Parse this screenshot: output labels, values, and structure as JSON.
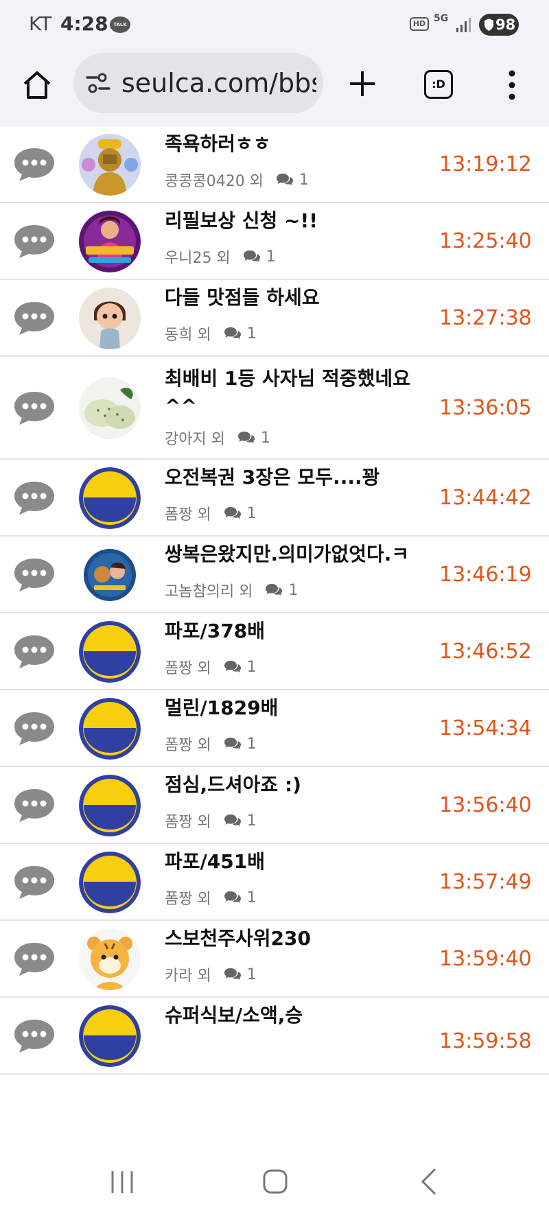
{
  "status_bar": {
    "carrier": "KT",
    "time": "4:28",
    "talk_badge": "TALK",
    "hd_badge": "HD",
    "network": "5G",
    "battery": "98",
    "icons": [
      "kakaotalk-icon",
      "hd-voice-icon",
      "5g-icon",
      "signal-icon",
      "battery-icon"
    ]
  },
  "browser": {
    "url": "seulca.com/bbs",
    "tabs_label": ":D",
    "icons": [
      "home-icon",
      "site-settings-icon",
      "new-tab-icon",
      "tab-switcher-icon",
      "more-menu-icon"
    ]
  },
  "colors": {
    "time": "#e0561a",
    "meta": "#777777",
    "divider": "#e4e4e4"
  },
  "posts": [
    {
      "title": "족욕하러ㅎㅎ",
      "author": "콩콩콩0420 외",
      "comments": "1",
      "time": "13:19:12",
      "avatar": "gold-figure"
    },
    {
      "title": "리필보상 신청 ~!!",
      "author": "우니25 외",
      "comments": "1",
      "time": "13:25:40",
      "avatar": "game-character"
    },
    {
      "title": "다들 맛점들 하세요",
      "author": "동희 외",
      "comments": "1",
      "time": "13:27:38",
      "avatar": "toddler-doll"
    },
    {
      "title": "최배비 1등 사자님 적중했네요 ^^",
      "author": "강아지 외",
      "comments": "1",
      "time": "13:36:05",
      "avatar": "rice-cakes"
    },
    {
      "title": "오전복권 3장은 모두....꽝",
      "author": "폼짱 외",
      "comments": "1",
      "time": "13:44:42",
      "avatar": "yellow-smile"
    },
    {
      "title": "쌍복은왔지만.의미가없엇다.ㅋ",
      "author": "고놈참의리 외",
      "comments": "1",
      "time": "13:46:19",
      "avatar": "game-banner"
    },
    {
      "title": "파포/378배",
      "author": "폼짱 외",
      "comments": "1",
      "time": "13:46:52",
      "avatar": "yellow-smile"
    },
    {
      "title": "멀린/1829배",
      "author": "폼짱 외",
      "comments": "1",
      "time": "13:54:34",
      "avatar": "yellow-smile"
    },
    {
      "title": "점심,드셔아죠 :)",
      "author": "폼짱 외",
      "comments": "1",
      "time": "13:56:40",
      "avatar": "yellow-smile"
    },
    {
      "title": "파포/451배",
      "author": "폼짱 외",
      "comments": "1",
      "time": "13:57:49",
      "avatar": "yellow-smile"
    },
    {
      "title": "스보천주사위230",
      "author": "카라 외",
      "comments": "1",
      "time": "13:59:40",
      "avatar": "tiger-cub"
    },
    {
      "title": "슈퍼식보/소액,승",
      "author": "",
      "comments": "",
      "time": "13:59:58",
      "avatar": "yellow-smile"
    }
  ],
  "nav": {
    "icons": [
      "recent-apps-icon",
      "home-nav-icon",
      "back-icon"
    ]
  }
}
